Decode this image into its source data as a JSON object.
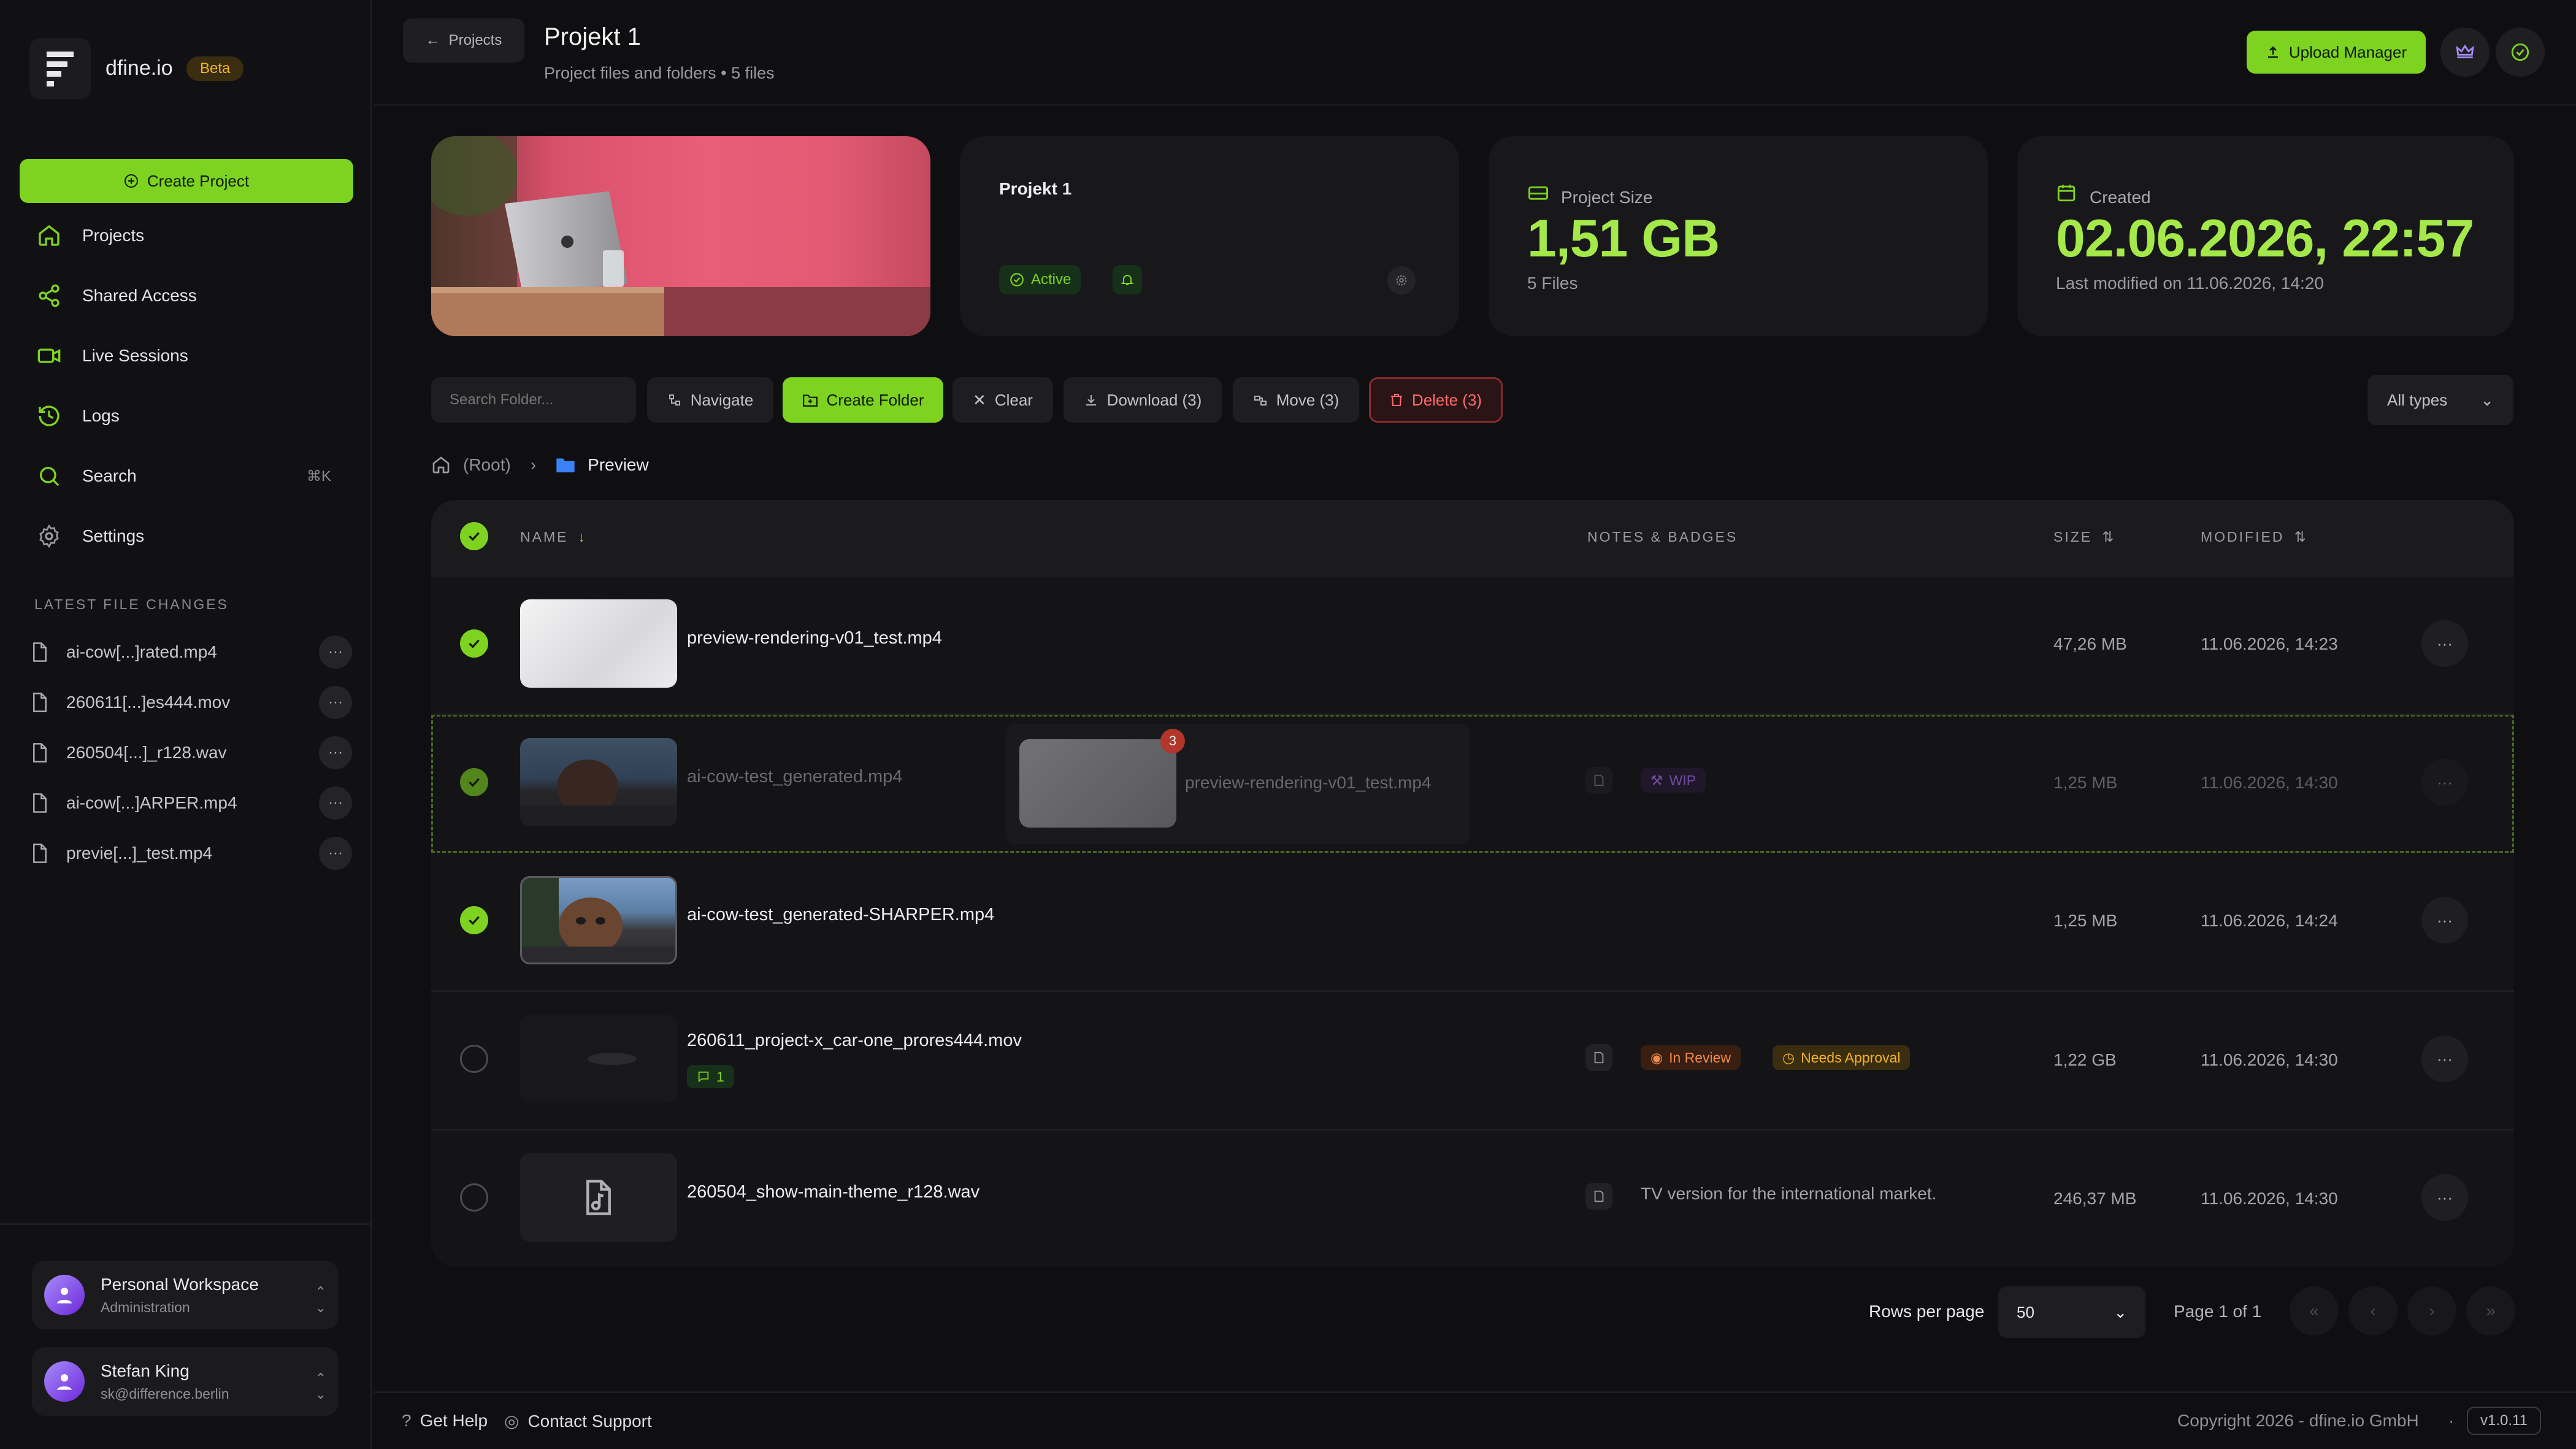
{
  "brand": {
    "name": "dfine.io",
    "badge": "Beta"
  },
  "sidebar": {
    "create_label": "Create Project",
    "nav": [
      {
        "label": "Projects",
        "icon": "home-icon"
      },
      {
        "label": "Shared Access",
        "icon": "share-icon"
      },
      {
        "label": "Live Sessions",
        "icon": "video-icon"
      },
      {
        "label": "Logs",
        "icon": "history-icon"
      },
      {
        "label": "Search",
        "icon": "search-icon",
        "shortcut": "⌘K"
      },
      {
        "label": "Settings",
        "icon": "gear-icon"
      }
    ],
    "latest_title": "LATEST FILE CHANGES",
    "latest_files": [
      "ai-cow[...]rated.mp4",
      "260611[...]es444.mov",
      "260504[...]_r128.wav",
      "ai-cow[...]ARPER.mp4",
      "previe[...]_test.mp4"
    ],
    "workspace": {
      "name": "Personal Workspace",
      "role": "Administration"
    },
    "user": {
      "name": "Stefan King",
      "email": "sk@difference.berlin"
    }
  },
  "header": {
    "back_label": "Projects",
    "title": "Projekt 1",
    "subtitle": "Project files and folders • 5 files",
    "upload_label": "Upload Manager"
  },
  "cards": {
    "project": {
      "name": "Projekt 1",
      "status": "Active"
    },
    "size": {
      "label": "Project Size",
      "value": "1,51 GB",
      "sub": "5 Files"
    },
    "created": {
      "label": "Created",
      "value": "02.06.2026, 22:57",
      "sub": "Last modified on 11.06.2026, 14:20"
    }
  },
  "toolbar": {
    "search_placeholder": "Search Folder...",
    "navigate": "Navigate",
    "create_folder": "Create Folder",
    "clear": "Clear",
    "download": "Download (3)",
    "move": "Move (3)",
    "delete": "Delete (3)",
    "type_filter": "All types"
  },
  "breadcrumb": {
    "root": "(Root)",
    "current": "Preview"
  },
  "table": {
    "headers": {
      "name": "NAME",
      "notes": "NOTES & BADGES",
      "size": "SIZE",
      "modified": "MODIFIED"
    },
    "rows": [
      {
        "name": "preview-rendering-v01_test.mp4",
        "size": "47,26 MB",
        "modified": "11.06.2026, 14:23",
        "selected": true
      },
      {
        "name": "ai-cow-test_generated.mp4",
        "size": "1,25 MB",
        "modified": "11.06.2026, 14:30",
        "selected": true,
        "badge": "WIP"
      },
      {
        "name": "ai-cow-test_generated-SHARPER.mp4",
        "size": "1,25 MB",
        "modified": "11.06.2026, 14:24",
        "selected": true
      },
      {
        "name": "260611_project-x_car-one_prores444.mov",
        "size": "1,22 GB",
        "modified": "11.06.2026, 14:30",
        "selected": false,
        "comments": "1",
        "badges": [
          "In Review",
          "Needs Approval"
        ]
      },
      {
        "name": "260504_show-main-theme_r128.wav",
        "size": "246,37 MB",
        "modified": "11.06.2026, 14:30",
        "selected": false,
        "note": "TV version for the international market."
      }
    ],
    "drag_ghost": {
      "name": "preview-rendering-v01_test.mp4",
      "count": "3"
    }
  },
  "pagination": {
    "rows_label": "Rows per page",
    "rows_value": "50",
    "page_label": "Page 1 of 1"
  },
  "footer": {
    "help": "Get Help",
    "support": "Contact Support",
    "copyright": "Copyright 2026 - dfine.io GmbH",
    "dot": "·",
    "version": "v1.0.11"
  },
  "colors": {
    "accent": "#7ed321",
    "accent_text": "#a4e84a",
    "danger": "#e5484d",
    "background": "#0f0f11",
    "card": "#18181b"
  }
}
